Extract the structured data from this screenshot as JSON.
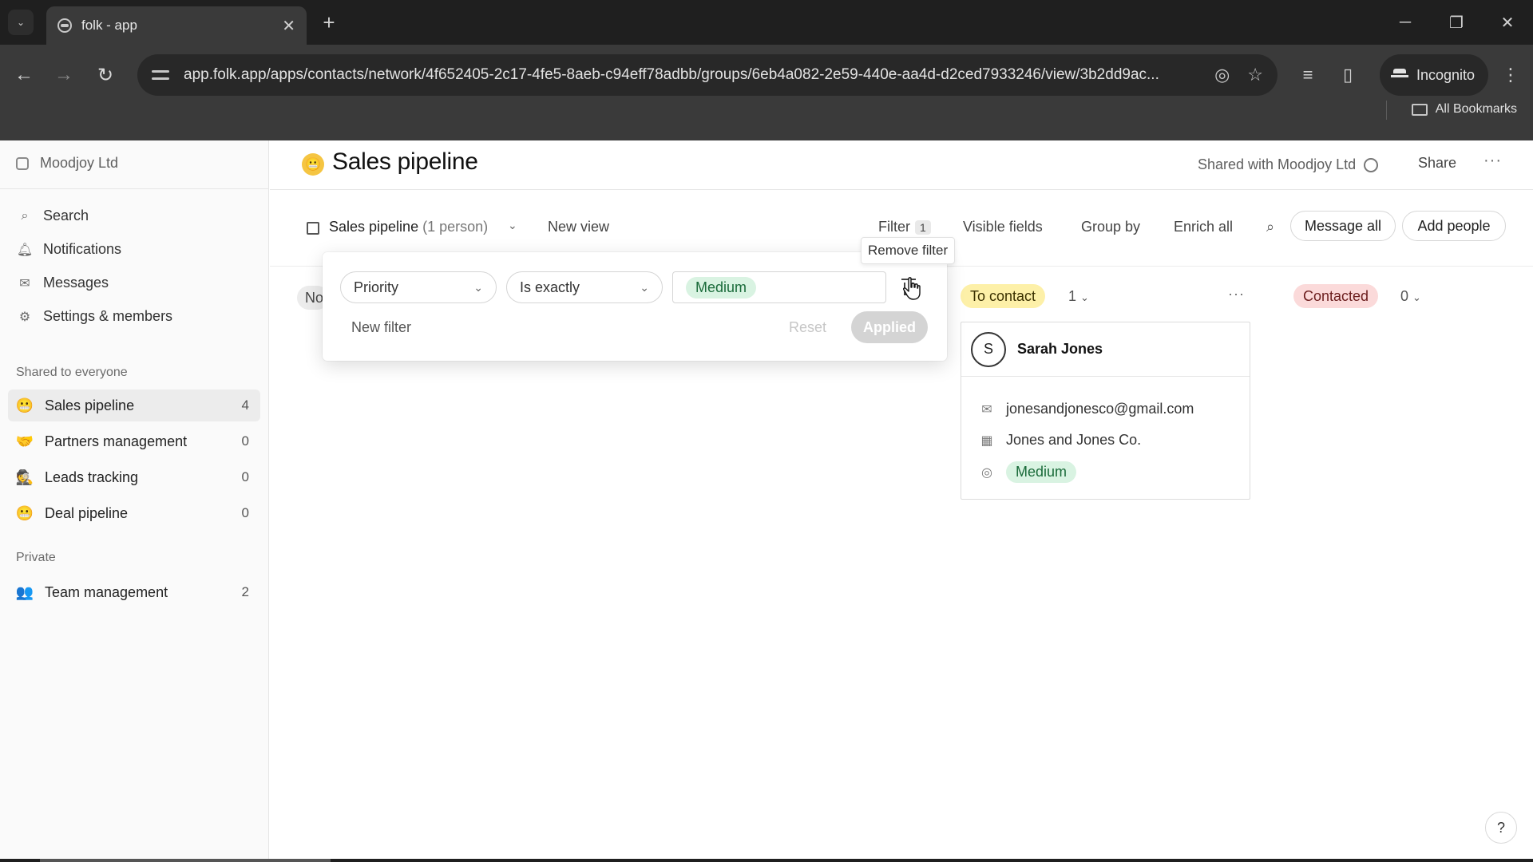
{
  "browser": {
    "tab_title": "folk - app",
    "url": "app.folk.app/apps/contacts/network/4f652405-2c17-4fe5-8aeb-c94eff78adbb/groups/6eb4a082-2e59-440e-aa4d-d2ced7933246/view/3b2dd9ac...",
    "profile_label": "Incognito",
    "bookmarks_label": "All Bookmarks"
  },
  "sidebar": {
    "workspace": "Moodjoy Ltd",
    "nav": [
      {
        "label": "Search",
        "icon": "search-icon"
      },
      {
        "label": "Notifications",
        "icon": "bell-icon"
      },
      {
        "label": "Messages",
        "icon": "mail-icon"
      },
      {
        "label": "Settings & members",
        "icon": "gear-icon"
      }
    ],
    "shared_section": "Shared to everyone",
    "shared_items": [
      {
        "label": "Sales pipeline",
        "count": "4",
        "emoji": "😬"
      },
      {
        "label": "Partners management",
        "count": "0",
        "emoji": "🤝"
      },
      {
        "label": "Leads tracking",
        "count": "0",
        "emoji": "🕵"
      },
      {
        "label": "Deal pipeline",
        "count": "0",
        "emoji": "😬"
      }
    ],
    "private_section": "Private",
    "private_items": [
      {
        "label": "Team management",
        "count": "2",
        "emoji": "👥"
      }
    ]
  },
  "page": {
    "title": "Sales pipeline",
    "emoji": "😬",
    "shared_with": "Shared with Moodjoy Ltd",
    "share_label": "Share",
    "more_label": "···"
  },
  "viewbar": {
    "view_name": "Sales pipeline",
    "view_count": "(1 person)",
    "new_view": "New view",
    "filter_label": "Filter",
    "filter_count": "1",
    "visible_fields": "Visible fields",
    "group_by": "Group by",
    "enrich_all": "Enrich all",
    "message_all": "Message all",
    "add_people": "Add people"
  },
  "filter_popover": {
    "field": "Priority",
    "operator": "Is exactly",
    "value": "Medium",
    "new_filter": "New filter",
    "reset": "Reset",
    "applied": "Applied",
    "tooltip": "Remove filter"
  },
  "columns": [
    {
      "label": "No",
      "color": "#ececec"
    },
    {
      "label": "To contact",
      "count": "1",
      "color": "#fdf0a8"
    },
    {
      "label": "Contacted",
      "count": "0",
      "color": "#fbdada"
    }
  ],
  "card": {
    "avatar": "S",
    "name": "Sarah Jones",
    "email": "jonesandjonesco@gmail.com",
    "company": "Jones and Jones Co.",
    "priority": "Medium"
  },
  "help_label": "?"
}
